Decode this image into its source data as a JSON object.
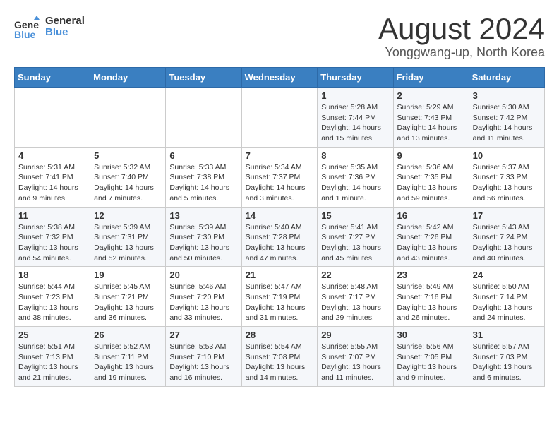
{
  "header": {
    "logo_line1": "General",
    "logo_line2": "Blue",
    "month": "August 2024",
    "location": "Yonggwang-up, North Korea"
  },
  "weekdays": [
    "Sunday",
    "Monday",
    "Tuesday",
    "Wednesday",
    "Thursday",
    "Friday",
    "Saturday"
  ],
  "weeks": [
    [
      {
        "day": "",
        "info": ""
      },
      {
        "day": "",
        "info": ""
      },
      {
        "day": "",
        "info": ""
      },
      {
        "day": "",
        "info": ""
      },
      {
        "day": "1",
        "info": "Sunrise: 5:28 AM\nSunset: 7:44 PM\nDaylight: 14 hours\nand 15 minutes."
      },
      {
        "day": "2",
        "info": "Sunrise: 5:29 AM\nSunset: 7:43 PM\nDaylight: 14 hours\nand 13 minutes."
      },
      {
        "day": "3",
        "info": "Sunrise: 5:30 AM\nSunset: 7:42 PM\nDaylight: 14 hours\nand 11 minutes."
      }
    ],
    [
      {
        "day": "4",
        "info": "Sunrise: 5:31 AM\nSunset: 7:41 PM\nDaylight: 14 hours\nand 9 minutes."
      },
      {
        "day": "5",
        "info": "Sunrise: 5:32 AM\nSunset: 7:40 PM\nDaylight: 14 hours\nand 7 minutes."
      },
      {
        "day": "6",
        "info": "Sunrise: 5:33 AM\nSunset: 7:38 PM\nDaylight: 14 hours\nand 5 minutes."
      },
      {
        "day": "7",
        "info": "Sunrise: 5:34 AM\nSunset: 7:37 PM\nDaylight: 14 hours\nand 3 minutes."
      },
      {
        "day": "8",
        "info": "Sunrise: 5:35 AM\nSunset: 7:36 PM\nDaylight: 14 hours\nand 1 minute."
      },
      {
        "day": "9",
        "info": "Sunrise: 5:36 AM\nSunset: 7:35 PM\nDaylight: 13 hours\nand 59 minutes."
      },
      {
        "day": "10",
        "info": "Sunrise: 5:37 AM\nSunset: 7:33 PM\nDaylight: 13 hours\nand 56 minutes."
      }
    ],
    [
      {
        "day": "11",
        "info": "Sunrise: 5:38 AM\nSunset: 7:32 PM\nDaylight: 13 hours\nand 54 minutes."
      },
      {
        "day": "12",
        "info": "Sunrise: 5:39 AM\nSunset: 7:31 PM\nDaylight: 13 hours\nand 52 minutes."
      },
      {
        "day": "13",
        "info": "Sunrise: 5:39 AM\nSunset: 7:30 PM\nDaylight: 13 hours\nand 50 minutes."
      },
      {
        "day": "14",
        "info": "Sunrise: 5:40 AM\nSunset: 7:28 PM\nDaylight: 13 hours\nand 47 minutes."
      },
      {
        "day": "15",
        "info": "Sunrise: 5:41 AM\nSunset: 7:27 PM\nDaylight: 13 hours\nand 45 minutes."
      },
      {
        "day": "16",
        "info": "Sunrise: 5:42 AM\nSunset: 7:26 PM\nDaylight: 13 hours\nand 43 minutes."
      },
      {
        "day": "17",
        "info": "Sunrise: 5:43 AM\nSunset: 7:24 PM\nDaylight: 13 hours\nand 40 minutes."
      }
    ],
    [
      {
        "day": "18",
        "info": "Sunrise: 5:44 AM\nSunset: 7:23 PM\nDaylight: 13 hours\nand 38 minutes."
      },
      {
        "day": "19",
        "info": "Sunrise: 5:45 AM\nSunset: 7:21 PM\nDaylight: 13 hours\nand 36 minutes."
      },
      {
        "day": "20",
        "info": "Sunrise: 5:46 AM\nSunset: 7:20 PM\nDaylight: 13 hours\nand 33 minutes."
      },
      {
        "day": "21",
        "info": "Sunrise: 5:47 AM\nSunset: 7:19 PM\nDaylight: 13 hours\nand 31 minutes."
      },
      {
        "day": "22",
        "info": "Sunrise: 5:48 AM\nSunset: 7:17 PM\nDaylight: 13 hours\nand 29 minutes."
      },
      {
        "day": "23",
        "info": "Sunrise: 5:49 AM\nSunset: 7:16 PM\nDaylight: 13 hours\nand 26 minutes."
      },
      {
        "day": "24",
        "info": "Sunrise: 5:50 AM\nSunset: 7:14 PM\nDaylight: 13 hours\nand 24 minutes."
      }
    ],
    [
      {
        "day": "25",
        "info": "Sunrise: 5:51 AM\nSunset: 7:13 PM\nDaylight: 13 hours\nand 21 minutes."
      },
      {
        "day": "26",
        "info": "Sunrise: 5:52 AM\nSunset: 7:11 PM\nDaylight: 13 hours\nand 19 minutes."
      },
      {
        "day": "27",
        "info": "Sunrise: 5:53 AM\nSunset: 7:10 PM\nDaylight: 13 hours\nand 16 minutes."
      },
      {
        "day": "28",
        "info": "Sunrise: 5:54 AM\nSunset: 7:08 PM\nDaylight: 13 hours\nand 14 minutes."
      },
      {
        "day": "29",
        "info": "Sunrise: 5:55 AM\nSunset: 7:07 PM\nDaylight: 13 hours\nand 11 minutes."
      },
      {
        "day": "30",
        "info": "Sunrise: 5:56 AM\nSunset: 7:05 PM\nDaylight: 13 hours\nand 9 minutes."
      },
      {
        "day": "31",
        "info": "Sunrise: 5:57 AM\nSunset: 7:03 PM\nDaylight: 13 hours\nand 6 minutes."
      }
    ]
  ]
}
